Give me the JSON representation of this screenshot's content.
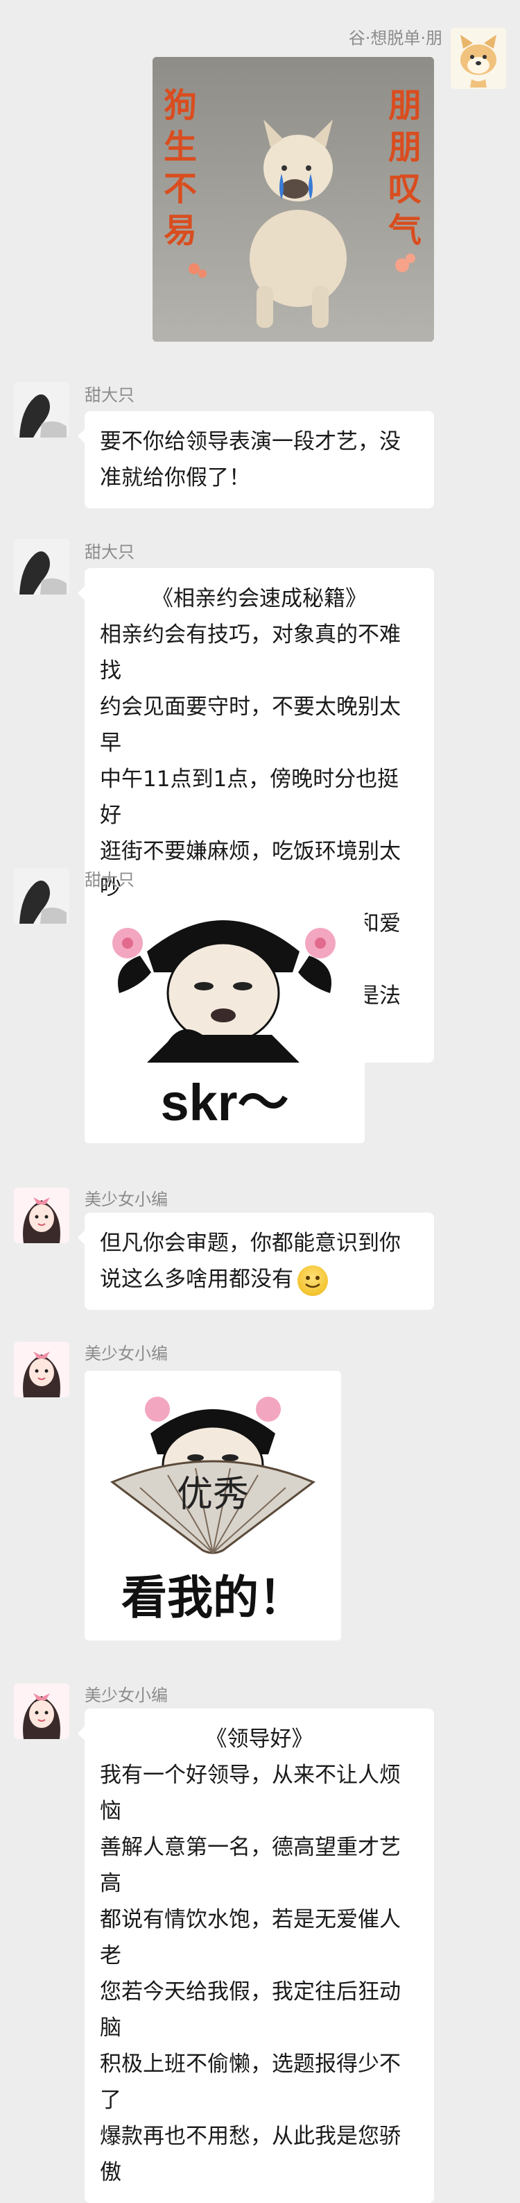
{
  "header_sender": "谷·想脱单·朋",
  "sticker_dog": {
    "left_text": "狗生不易",
    "right_text": "朋朋叹气"
  },
  "messages": [
    {
      "sender": "甜大只",
      "lines": [
        "要不你给领导表演一段才艺，没",
        "准就给你假了！"
      ]
    },
    {
      "sender": "甜大只",
      "title": "《相亲约会速成秘籍》",
      "lines": [
        "相亲约会有技巧，对象真的不难找",
        "约会见面要守时，不要太晚别太早",
        "中午11点到1点，傍晚时分也挺好",
        "逛街不要嫌麻烦，吃饭环境别太吵",
        "言谈举止要大方，聊聊兴趣和爱好",
        "凡事考虑要周全，真诚沟通是法宝"
      ]
    },
    {
      "sender": "甜大只",
      "sticker_text": "skr～"
    },
    {
      "sender": "美少女小编",
      "lines": [
        "但凡你会审题，你都能意识到你",
        "说这么多啥用都没有"
      ]
    },
    {
      "sender": "美少女小编",
      "sticker_fan_text": "优秀",
      "sticker_text": "看我的！"
    },
    {
      "sender": "美少女小编",
      "title": "《领导好》",
      "lines": [
        "我有一个好领导，从来不让人烦恼",
        "善解人意第一名，德高望重才艺高",
        "都说有情饮水饱，若是无爱催人老",
        "您若今天给我假，我定往后狂动脑",
        "积极上班不偷懒，选题报得少不了",
        "爆款再也不用愁，从此我是您骄傲"
      ]
    }
  ]
}
